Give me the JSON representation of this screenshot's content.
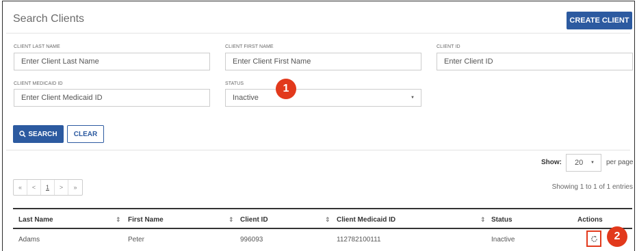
{
  "header": {
    "title": "Search Clients",
    "create_label": "CREATE CLIENT"
  },
  "fields": {
    "last_name": {
      "label": "CLIENT LAST NAME",
      "placeholder": "Enter Client Last Name"
    },
    "first_name": {
      "label": "CLIENT FIRST NAME",
      "placeholder": "Enter Client First Name"
    },
    "client_id": {
      "label": "CLIENT ID",
      "placeholder": "Enter Client ID"
    },
    "medicaid_id": {
      "label": "CLIENT MEDICAID ID",
      "placeholder": "Enter Client Medicaid ID"
    },
    "status": {
      "label": "STATUS",
      "value": "Inactive"
    }
  },
  "badges": {
    "first": "1",
    "second": "2"
  },
  "buttons": {
    "search_label": "SEARCH",
    "clear_label": "CLEAR"
  },
  "paging": {
    "show_label": "Show:",
    "per_page_value": "20",
    "per_page_label": "per page",
    "entries_text": "Showing 1 to 1 of 1 entries",
    "buttons": [
      "«",
      "<",
      "1",
      ">",
      "»"
    ]
  },
  "table": {
    "headers": [
      "Last Name",
      "First Name",
      "Client ID",
      "Client Medicaid ID",
      "Status",
      "Actions"
    ],
    "sort_glyph": "⇕",
    "rows": [
      {
        "last_name": "Adams",
        "first_name": "Peter",
        "client_id": "996093",
        "medicaid_id": "112782100111",
        "status": "Inactive"
      }
    ]
  },
  "icons": {
    "search": "search-icon",
    "reactivate": "refresh-icon"
  },
  "colors": {
    "primary": "#2c5aa0",
    "badge": "#e2391c"
  }
}
